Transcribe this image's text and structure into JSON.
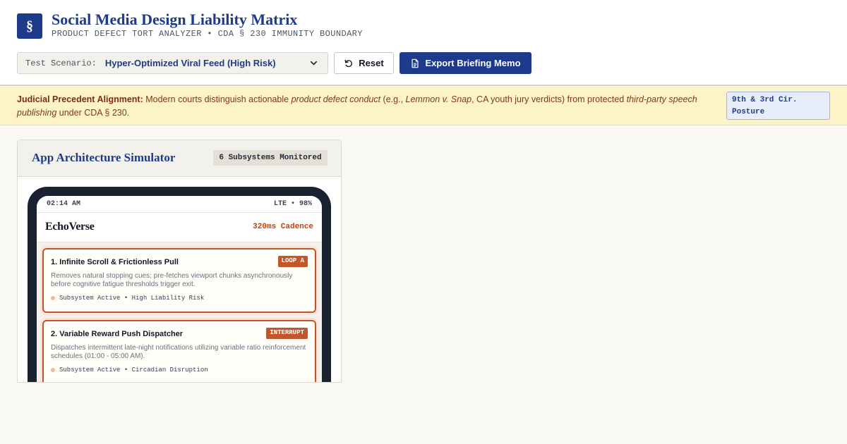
{
  "header": {
    "logo_glyph": "§",
    "title": "Social Media Design Liability Matrix",
    "subtitle": "PRODUCT DEFECT TORT ANALYZER • CDA § 230 IMMUNITY BOUNDARY"
  },
  "toolbar": {
    "scenario_label": "Test Scenario:",
    "scenario_value": "Hyper-Optimized Viral Feed (High Risk)",
    "reset_label": "Reset",
    "export_label": "Export Briefing Memo"
  },
  "banner": {
    "lead": "Judicial Precedent Alignment:",
    "t1": " Modern courts distinguish actionable ",
    "em1": "product defect conduct",
    "t2": " (e.g., ",
    "em2": "Lemmon v. Snap",
    "t3": ", CA youth jury verdicts) from protected ",
    "em3": "third-party speech publishing",
    "t4": " under CDA § 230.",
    "badge_line1": "9th & 3rd Cir.",
    "badge_line2": "Posture"
  },
  "panel": {
    "title": "App Architecture Simulator",
    "badge": "6 Subsystems Monitored"
  },
  "phone": {
    "time": "02:14 AM",
    "signal": "LTE • 98%",
    "app_name": "EchoVerse",
    "cadence": "320ms Cadence",
    "cards": [
      {
        "title": "1. Infinite Scroll & Frictionless Pull",
        "tag": "LOOP A",
        "desc": "Removes natural stopping cues; pre-fetches viewport chunks asynchronously before cognitive fatigue thresholds trigger exit.",
        "status": "Subsystem Active • High Liability Risk"
      },
      {
        "title": "2. Variable Reward Push Dispatcher",
        "tag": "INTERRUPT",
        "desc": "Dispatches intermittent late-night notifications utilizing variable ratio reinforcement schedules (01:00 - 05:00 AM).",
        "status": "Subsystem Active • Circadian Disruption"
      }
    ]
  },
  "colors": {
    "brand": "#1e3a8a",
    "risk": "#c2562a",
    "banner_bg": "#fdf3c9"
  },
  "icons": {
    "scenario": "chevron-down-icon",
    "reset": "reset-icon",
    "export": "document-icon"
  }
}
